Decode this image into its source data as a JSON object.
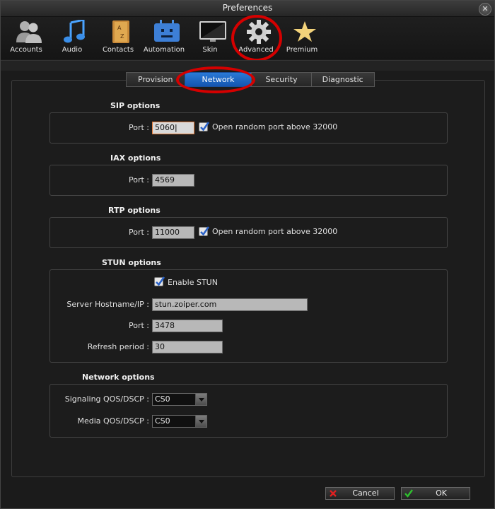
{
  "window": {
    "title": "Preferences"
  },
  "toolbar": {
    "items": [
      {
        "label": "Accounts",
        "icon": "accounts-icon"
      },
      {
        "label": "Audio",
        "icon": "music-note-icon"
      },
      {
        "label": "Contacts",
        "icon": "address-book-icon"
      },
      {
        "label": "Automation",
        "icon": "robot-icon"
      },
      {
        "label": "Skin",
        "icon": "monitor-icon"
      },
      {
        "label": "Advanced",
        "icon": "gear-icon"
      },
      {
        "label": "Premium",
        "icon": "star-icon"
      }
    ],
    "selected": "Advanced"
  },
  "tabs": {
    "items": [
      "Provision",
      "Network",
      "Security",
      "Diagnostic"
    ],
    "active": "Network"
  },
  "sip": {
    "title": "SIP options",
    "port_label": "Port :",
    "port_value": "5060",
    "random_port_checked": true,
    "random_port_label": "Open random port above 32000"
  },
  "iax": {
    "title": "IAX options",
    "port_label": "Port :",
    "port_value": "4569"
  },
  "rtp": {
    "title": "RTP options",
    "port_label": "Port :",
    "port_value": "11000",
    "random_port_checked": true,
    "random_port_label": "Open random port above 32000"
  },
  "stun": {
    "title": "STUN options",
    "enable_checked": true,
    "enable_label": "Enable STUN",
    "host_label": "Server Hostname/IP :",
    "host_value": "stun.zoiper.com",
    "port_label": "Port :",
    "port_value": "3478",
    "refresh_label": "Refresh period :",
    "refresh_value": "30"
  },
  "network": {
    "title": "Network options",
    "signaling_label": "Signaling QOS/DSCP :",
    "signaling_value": "CS0",
    "media_label": "Media QOS/DSCP :",
    "media_value": "CS0"
  },
  "buttons": {
    "cancel_label": "Cancel",
    "ok_label": "OK"
  },
  "colors": {
    "accent_tab": "#1e66c4",
    "highlight_ring": "#d50000",
    "focus_border": "#e07a3a"
  }
}
